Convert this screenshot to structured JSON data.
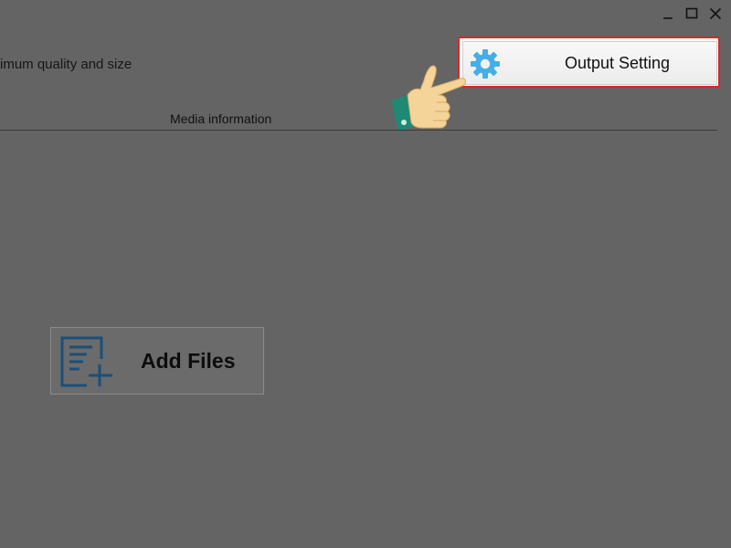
{
  "window": {
    "controls": [
      "minimize",
      "maximize",
      "close"
    ]
  },
  "header": {
    "subtitle": "imum quality and size"
  },
  "toolbar": {
    "output_setting_label": "Output Setting",
    "output_setting_icon": "gear-icon",
    "highlight_color": "#d8262b",
    "icon_color": "#45aee6"
  },
  "tabs": {
    "media_information": "Media information"
  },
  "main": {
    "add_files_label": "Add Files",
    "add_files_icon": "add-file-icon",
    "add_files_icon_color": "#1a4f7a"
  },
  "annotation": {
    "pointer_icon": "pointing-hand-icon"
  }
}
